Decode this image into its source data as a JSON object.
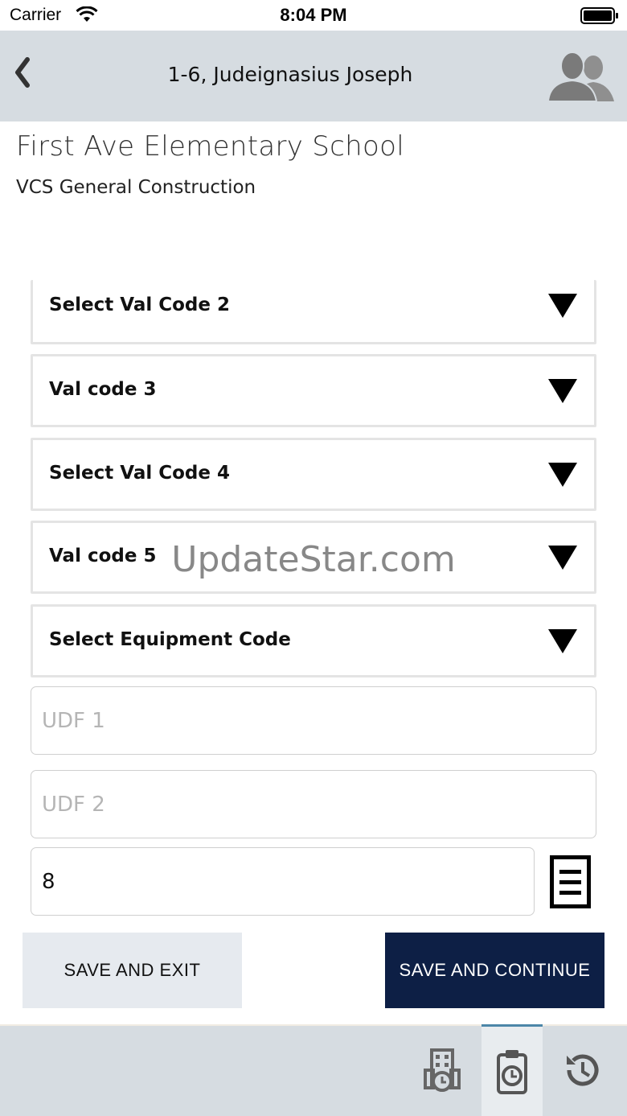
{
  "status_bar": {
    "carrier": "Carrier",
    "time": "8:04 PM"
  },
  "nav": {
    "title": "1-6, Judeignasius Joseph"
  },
  "header": {
    "project": "First Ave Elementary School",
    "company": "VCS General Construction"
  },
  "dropdowns": {
    "val_code_2": "Select Val Code 2",
    "val_code_3": "Val code 3",
    "val_code_4": "Select Val Code 4",
    "val_code_5": "Val code 5",
    "equipment_code": "Select Equipment Code"
  },
  "watermark": "UpdateStar.com",
  "fields": {
    "udf1": {
      "placeholder": "UDF 1",
      "value": ""
    },
    "udf2": {
      "placeholder": "UDF 2",
      "value": ""
    },
    "hours": {
      "value": "8"
    }
  },
  "buttons": {
    "save_exit": "SAVE AND EXIT",
    "save_continue": "SAVE AND CONTINUE"
  },
  "tab_bar": {
    "tabs": [
      {
        "icon": "building-clock-icon",
        "active": false
      },
      {
        "icon": "clipboard-clock-icon",
        "active": true
      },
      {
        "icon": "history-icon",
        "active": false
      }
    ]
  },
  "colors": {
    "nav_background": "#d6dce1",
    "primary_button": "#0d1f45",
    "secondary_button": "#e6eaef",
    "active_tab_indicator": "#4c86a8"
  }
}
